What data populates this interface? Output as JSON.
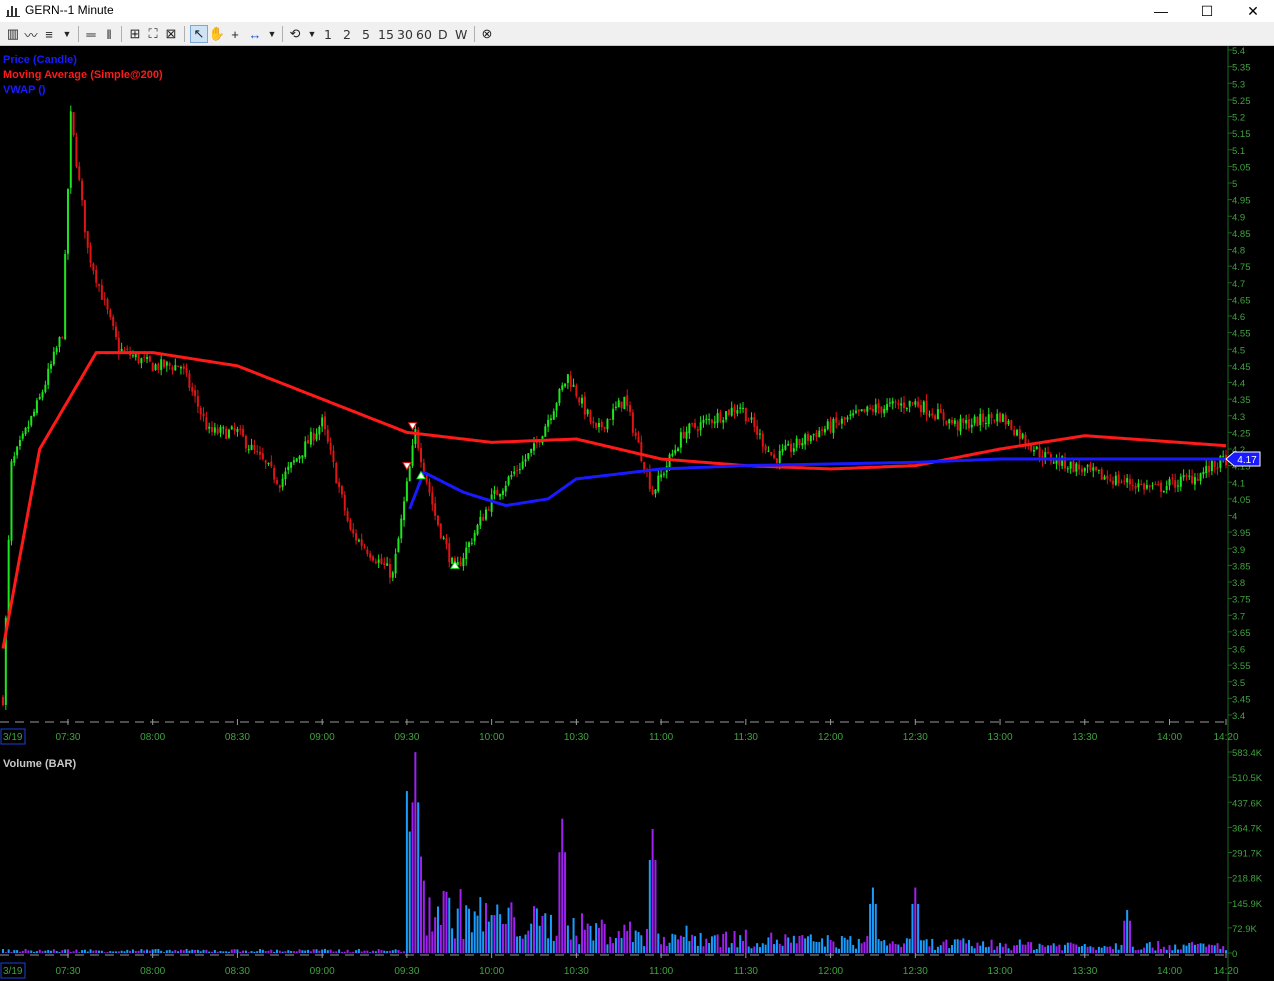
{
  "window": {
    "title": "GERN--1 Minute",
    "controls": [
      "—",
      "☐",
      "✕"
    ]
  },
  "toolbar": {
    "intervals": [
      "1",
      "2",
      "5",
      "15",
      "30",
      "60",
      "D",
      "W"
    ]
  },
  "legend": {
    "price": "Price (Candle)",
    "ma": "Moving Average (Simple@200)",
    "vwap": "VWAP ()",
    "volume": "Volume (BAR)"
  },
  "colors": {
    "up": "#1ee61e",
    "down": "#e01414",
    "ma": "#ff1a1a",
    "vwap": "#1a1aff",
    "vol_a": "#1a9cff",
    "vol_b": "#a020f0",
    "axis_text": "#3fa33f",
    "time_text": "#3fa33f",
    "price_label_bg": "#1a1aff"
  },
  "price_axis": {
    "min": 3.4,
    "max": 5.4,
    "ticks": [
      "5.4",
      "5.35",
      "5.3",
      "5.25",
      "5.2",
      "5.15",
      "5.1",
      "5.05",
      "5",
      "4.95",
      "4.9",
      "4.85",
      "4.8",
      "4.75",
      "4.7",
      "4.65",
      "4.6",
      "4.55",
      "4.5",
      "4.45",
      "4.4",
      "4.35",
      "4.3",
      "4.25",
      "4.2",
      "4.15",
      "4.1",
      "4.05",
      "4",
      "3.95",
      "3.9",
      "3.85",
      "3.8",
      "3.75",
      "3.7",
      "3.65",
      "3.6",
      "3.55",
      "3.5",
      "3.45",
      "3.4"
    ],
    "last_price_label": "4.17"
  },
  "volume_axis": {
    "max": 583.4,
    "ticks": [
      "583.4K",
      "510.5K",
      "437.6K",
      "364.7K",
      "291.7K",
      "218.8K",
      "145.9K",
      "72.9K",
      "0"
    ]
  },
  "time_axis": {
    "date_label": "3/19",
    "labels": [
      "07:30",
      "08:00",
      "08:30",
      "09:00",
      "09:30",
      "10:00",
      "10:30",
      "11:00",
      "11:30",
      "12:00",
      "12:30",
      "13:00",
      "13:30",
      "14:00",
      "14:20"
    ]
  },
  "chart_data": {
    "type": "candlestick",
    "symbol": "GERN",
    "interval": "1 Minute",
    "price_series_keypoints": [
      {
        "t": "07:07",
        "price": 3.45
      },
      {
        "t": "07:10",
        "price": 4.15
      },
      {
        "t": "07:20",
        "price": 4.35
      },
      {
        "t": "07:28",
        "price": 4.55
      },
      {
        "t": "07:31",
        "price": 5.2
      },
      {
        "t": "07:37",
        "price": 4.8
      },
      {
        "t": "07:48",
        "price": 4.5
      },
      {
        "t": "08:00",
        "price": 4.45
      },
      {
        "t": "08:10",
        "price": 4.45
      },
      {
        "t": "08:20",
        "price": 4.25
      },
      {
        "t": "08:30",
        "price": 4.25
      },
      {
        "t": "08:45",
        "price": 4.1
      },
      {
        "t": "09:00",
        "price": 4.28
      },
      {
        "t": "09:10",
        "price": 3.95
      },
      {
        "t": "09:25",
        "price": 3.82
      },
      {
        "t": "09:33",
        "price": 4.25
      },
      {
        "t": "09:40",
        "price": 4.0
      },
      {
        "t": "09:47",
        "price": 3.83
      },
      {
        "t": "10:00",
        "price": 4.05
      },
      {
        "t": "10:15",
        "price": 4.2
      },
      {
        "t": "10:27",
        "price": 4.42
      },
      {
        "t": "10:37",
        "price": 4.25
      },
      {
        "t": "10:47",
        "price": 4.35
      },
      {
        "t": "10:57",
        "price": 4.07
      },
      {
        "t": "11:08",
        "price": 4.25
      },
      {
        "t": "11:28",
        "price": 4.33
      },
      {
        "t": "11:40",
        "price": 4.17
      },
      {
        "t": "11:55",
        "price": 4.25
      },
      {
        "t": "12:15",
        "price": 4.32
      },
      {
        "t": "12:30",
        "price": 4.34
      },
      {
        "t": "12:45",
        "price": 4.27
      },
      {
        "t": "13:00",
        "price": 4.3
      },
      {
        "t": "13:15",
        "price": 4.18
      },
      {
        "t": "13:35",
        "price": 4.12
      },
      {
        "t": "13:55",
        "price": 4.08
      },
      {
        "t": "14:10",
        "price": 4.12
      },
      {
        "t": "14:20",
        "price": 4.17
      }
    ],
    "moving_average_keypoints": [
      {
        "t": "07:07",
        "value": 3.6
      },
      {
        "t": "07:20",
        "value": 4.2
      },
      {
        "t": "07:40",
        "value": 4.49
      },
      {
        "t": "08:00",
        "value": 4.49
      },
      {
        "t": "08:30",
        "value": 4.45
      },
      {
        "t": "09:00",
        "value": 4.35
      },
      {
        "t": "09:30",
        "value": 4.25
      },
      {
        "t": "10:00",
        "value": 4.22
      },
      {
        "t": "10:30",
        "value": 4.23
      },
      {
        "t": "11:00",
        "value": 4.17
      },
      {
        "t": "11:30",
        "value": 4.15
      },
      {
        "t": "12:00",
        "value": 4.14
      },
      {
        "t": "12:30",
        "value": 4.15
      },
      {
        "t": "13:00",
        "value": 4.2
      },
      {
        "t": "13:30",
        "value": 4.24
      },
      {
        "t": "14:20",
        "value": 4.21
      }
    ],
    "vwap_keypoints": [
      {
        "t": "09:31",
        "value": 4.02
      },
      {
        "t": "09:36",
        "value": 4.13
      },
      {
        "t": "09:50",
        "value": 4.07
      },
      {
        "t": "10:05",
        "value": 4.03
      },
      {
        "t": "10:20",
        "value": 4.05
      },
      {
        "t": "10:30",
        "value": 4.11
      },
      {
        "t": "11:00",
        "value": 4.14
      },
      {
        "t": "11:30",
        "value": 4.15
      },
      {
        "t": "12:30",
        "value": 4.16
      },
      {
        "t": "13:00",
        "value": 4.17
      },
      {
        "t": "14:20",
        "value": 4.17
      }
    ],
    "volume_keypoints_k": [
      {
        "t": "09:30",
        "volume": 470
      },
      {
        "t": "09:33",
        "volume": 583
      },
      {
        "t": "09:35",
        "volume": 280
      },
      {
        "t": "10:25",
        "volume": 390
      },
      {
        "t": "10:57",
        "volume": 360
      },
      {
        "t": "12:15",
        "volume": 190
      },
      {
        "t": "12:30",
        "volume": 190
      },
      {
        "t": "13:45",
        "volume": 125
      }
    ]
  }
}
